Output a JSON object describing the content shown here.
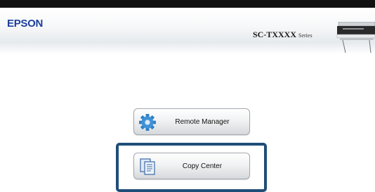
{
  "header": {
    "logo": "EPSON",
    "model": "SC-TXXXX",
    "model_suffix": "Series",
    "printer_icon": "printer-icon"
  },
  "menu": {
    "items": [
      {
        "label": "Remote Manager",
        "icon": "gear-icon"
      },
      {
        "label": "Copy Center",
        "icon": "document-icon"
      }
    ]
  },
  "highlight": {
    "color": "#1f4e79",
    "target": "Copy Center"
  },
  "colors": {
    "brand": "#1b3f9c",
    "top_bar": "#111111"
  }
}
